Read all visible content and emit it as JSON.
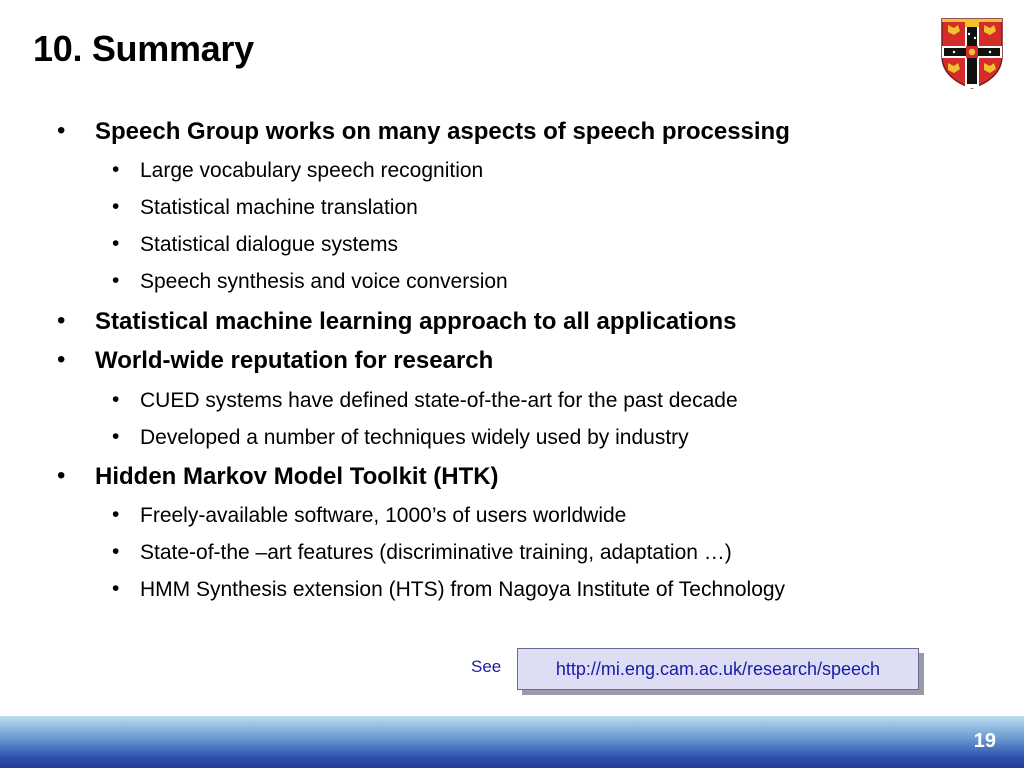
{
  "slide": {
    "title": "10. Summary",
    "bullets": [
      {
        "text": "Speech Group works on many aspects of speech processing",
        "sub": [
          "Large vocabulary speech recognition",
          "Statistical machine translation",
          "Statistical dialogue systems",
          "Speech synthesis and voice conversion"
        ]
      },
      {
        "text": "Statistical machine learning approach to all applications",
        "sub": []
      },
      {
        "text": "World-wide reputation for research",
        "sub": [
          "CUED systems have defined state-of-the-art for the past decade",
          "Developed a number of techniques widely used by industry"
        ]
      },
      {
        "text": "Hidden Markov Model Toolkit (HTK)",
        "sub": [
          "Freely-available software, 1000’s of users worldwide",
          "State-of-the –art features (discriminative training, adaptation …)",
          "HMM Synthesis extension (HTS) from Nagoya Institute of Technology"
        ]
      }
    ],
    "see_label": "See",
    "link": "http://mi.eng.cam.ac.uk/research/speech",
    "page_number": "19",
    "bullet_glyph": "•"
  },
  "colors": {
    "link_text": "#1a1aa8",
    "link_box_bg": "#ddddf4",
    "footer_top": "#b9def2",
    "footer_bottom": "#223c98",
    "crest_red": "#d42b2b",
    "crest_gold": "#f2c12e"
  },
  "icons": {
    "crest": "university-coat-of-arms-icon"
  }
}
